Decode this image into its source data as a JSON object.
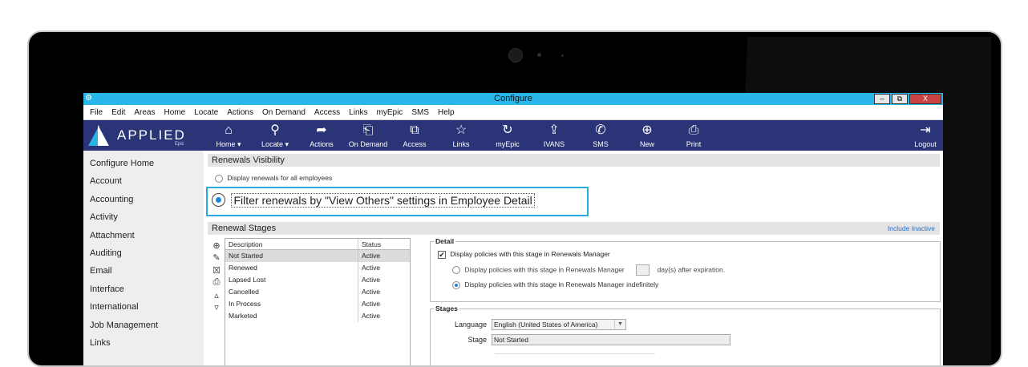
{
  "window": {
    "title": "Configure",
    "minimize": "‒",
    "restore": "⧉",
    "close": "X"
  },
  "menu": [
    "File",
    "Edit",
    "Areas",
    "Home",
    "Locate",
    "Actions",
    "On Demand",
    "Access",
    "Links",
    "myEpic",
    "SMS",
    "Help"
  ],
  "logo": {
    "text": "APPLIED",
    "sub": "Epic"
  },
  "toolbar": [
    {
      "label": "Home ▾",
      "icon": "home-icon",
      "glyph": "⌂"
    },
    {
      "label": "Locate ▾",
      "icon": "search-icon",
      "glyph": "⚲"
    },
    {
      "label": "Actions",
      "icon": "share-icon",
      "glyph": "➦"
    },
    {
      "label": "On Demand",
      "icon": "document-icon",
      "glyph": "⎗"
    },
    {
      "label": "Access",
      "icon": "access-icon",
      "glyph": "⧉"
    },
    {
      "label": "Links",
      "icon": "star-icon",
      "glyph": "☆"
    },
    {
      "label": "myEpic",
      "icon": "refresh-icon",
      "glyph": "↻"
    },
    {
      "label": "IVANS",
      "icon": "upload-icon",
      "glyph": "⇪"
    },
    {
      "label": "SMS",
      "icon": "phone-icon",
      "glyph": "✆"
    },
    {
      "label": "New",
      "icon": "plus-circle-icon",
      "glyph": "⊕"
    },
    {
      "label": "Print",
      "icon": "printer-icon",
      "glyph": "⎙"
    }
  ],
  "logout": {
    "label": "Logout",
    "glyph": "⇥"
  },
  "sidebar": [
    "Configure Home",
    "Account",
    "Accounting",
    "Activity",
    "Attachment",
    "Auditing",
    "Email",
    "Interface",
    "International",
    "Job Management",
    "Links"
  ],
  "visibility": {
    "header": "Renewals Visibility",
    "option_all": "Display renewals for all employees",
    "option_filter": "Filter renewals by \"View Others\" settings in Employee Detail"
  },
  "stages": {
    "header": "Renewal Stages",
    "include_inactive": "Include Inactive",
    "columns": [
      "Description",
      "Status"
    ],
    "rows": [
      {
        "description": "Not Started",
        "status": "Active"
      },
      {
        "description": "Renewed",
        "status": "Active"
      },
      {
        "description": "Lapsed Lost",
        "status": "Active"
      },
      {
        "description": "Cancelled",
        "status": "Active"
      },
      {
        "description": "In Process",
        "status": "Active"
      },
      {
        "description": "Marketed",
        "status": "Active"
      }
    ],
    "tools": [
      {
        "icon": "add-icon",
        "glyph": "⊕"
      },
      {
        "icon": "edit-icon",
        "glyph": "✎"
      },
      {
        "icon": "delete-icon",
        "glyph": "☒"
      },
      {
        "icon": "print-icon",
        "glyph": "⎙"
      },
      {
        "icon": "move-up-icon",
        "glyph": "▵"
      },
      {
        "icon": "move-down-icon",
        "glyph": "▿"
      }
    ]
  },
  "detail": {
    "legend": "Detail",
    "display_check": "Display policies with this stage in Renewals Manager",
    "check_mark": "✔",
    "option_days": "Display policies with this stage in Renewals Manager",
    "days_suffix": "day(s) after expiration.",
    "option_indef": "Display policies with this stage in Renewals Manager indefinitely"
  },
  "stage_form": {
    "legend": "Stages",
    "language_label": "Language",
    "language_value": "English (United States of America)",
    "stage_label": "Stage",
    "stage_value": "Not Started"
  }
}
